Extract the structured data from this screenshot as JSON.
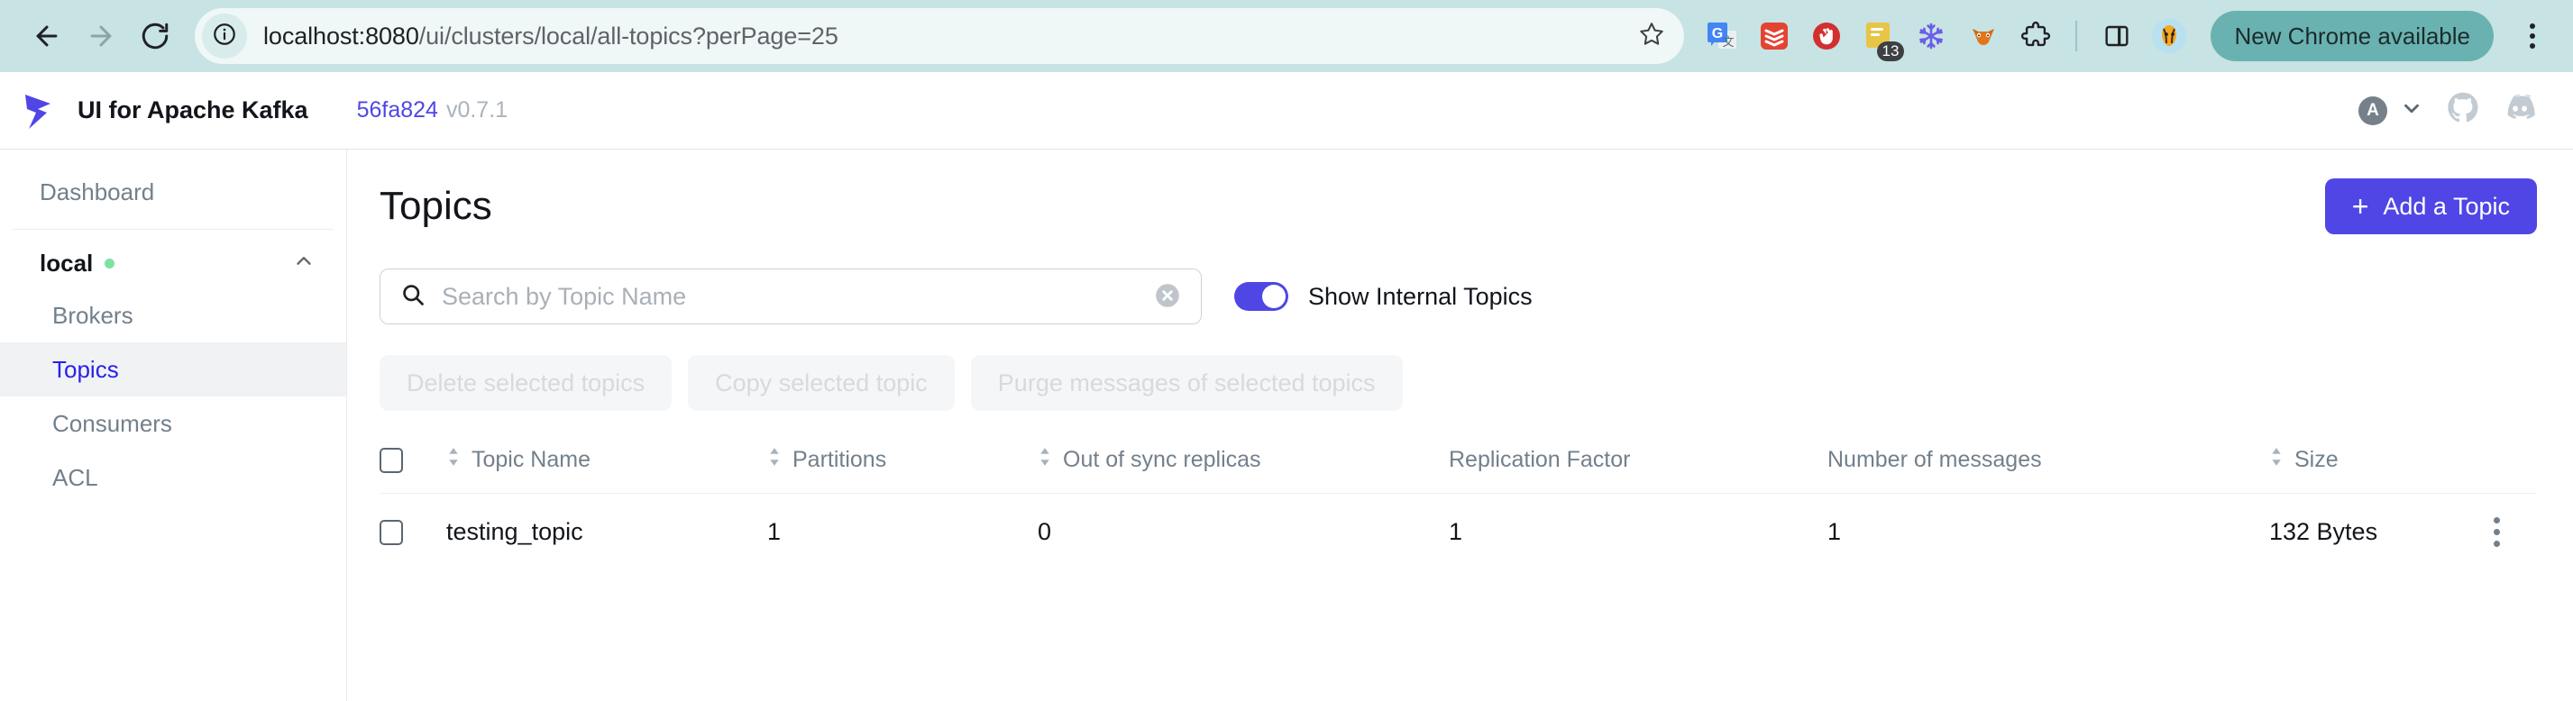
{
  "browser": {
    "back_icon": "arrow-left-icon",
    "forward_icon": "arrow-right-icon",
    "reload_icon": "reload-icon",
    "site_info_icon": "info-circle-icon",
    "url_host": "localhost:8080",
    "url_path": "/ui/clusters/local/all-topics?perPage=25",
    "url_full": "localhost:8080/ui/clusters/local/all-topics?perPage=25",
    "star_icon": "bookmark-star-icon",
    "extensions": [
      {
        "name": "google-translate-extension-icon",
        "badge": ""
      },
      {
        "name": "todoist-extension-icon",
        "badge": ""
      },
      {
        "name": "adblock-extension-icon",
        "badge": ""
      },
      {
        "name": "notes-extension-icon",
        "badge": "13"
      },
      {
        "name": "snowflake-extension-icon",
        "badge": ""
      },
      {
        "name": "metamask-extension-icon",
        "badge": ""
      },
      {
        "name": "extensions-puzzle-icon",
        "badge": ""
      }
    ],
    "side_panel_icon": "side-panel-icon",
    "profile_avatar_icon": "profile-avatar-icon",
    "update_pill_label": "New Chrome available",
    "chrome_menu_icon": "chrome-menu-kebab-icon"
  },
  "app_header": {
    "logo_icon": "kafka-ui-logo-icon",
    "title": "UI for Apache Kafka",
    "commit": "56fa824",
    "version": "v0.7.1",
    "avatar_letter": "A",
    "chevron_icon": "chevron-down-icon",
    "github_icon": "github-icon",
    "discord_icon": "discord-icon"
  },
  "sidebar": {
    "dashboard_label": "Dashboard",
    "cluster": {
      "name": "local",
      "status_dot_color": "#7ee2a0",
      "collapse_icon": "chevron-up-icon"
    },
    "items": [
      {
        "label": "Brokers",
        "active": false
      },
      {
        "label": "Topics",
        "active": true
      },
      {
        "label": "Consumers",
        "active": false
      },
      {
        "label": "ACL",
        "active": false
      }
    ]
  },
  "main": {
    "page_title": "Topics",
    "add_topic_button": "Add a Topic",
    "add_topic_plus_icon": "plus-icon",
    "search": {
      "icon": "search-icon",
      "placeholder": "Search by Topic Name",
      "value": "",
      "clear_icon": "clear-circle-x-icon"
    },
    "toggle": {
      "label": "Show Internal Topics",
      "state": "on",
      "color": "#4f46e5"
    },
    "action_buttons": [
      "Delete selected topics",
      "Copy selected topic",
      "Purge messages of selected topics"
    ],
    "table": {
      "select_all_checkbox": "",
      "columns": [
        {
          "label": "Topic Name",
          "sortable": true
        },
        {
          "label": "Partitions",
          "sortable": true
        },
        {
          "label": "Out of sync replicas",
          "sortable": true
        },
        {
          "label": "Replication Factor",
          "sortable": false
        },
        {
          "label": "Number of messages",
          "sortable": false
        },
        {
          "label": "Size",
          "sortable": true
        }
      ],
      "rows": [
        {
          "topic_name": "testing_topic",
          "partitions": "1",
          "out_of_sync_replicas": "0",
          "replication_factor": "1",
          "number_of_messages": "1",
          "size": "132 Bytes",
          "row_menu_icon": "row-kebab-menu-icon"
        }
      ]
    }
  },
  "colors": {
    "accent": "#4f46e5",
    "browser_chrome": "#c7e3e3",
    "active_nav_text": "#2a21e8",
    "muted_text": "#73808c"
  }
}
